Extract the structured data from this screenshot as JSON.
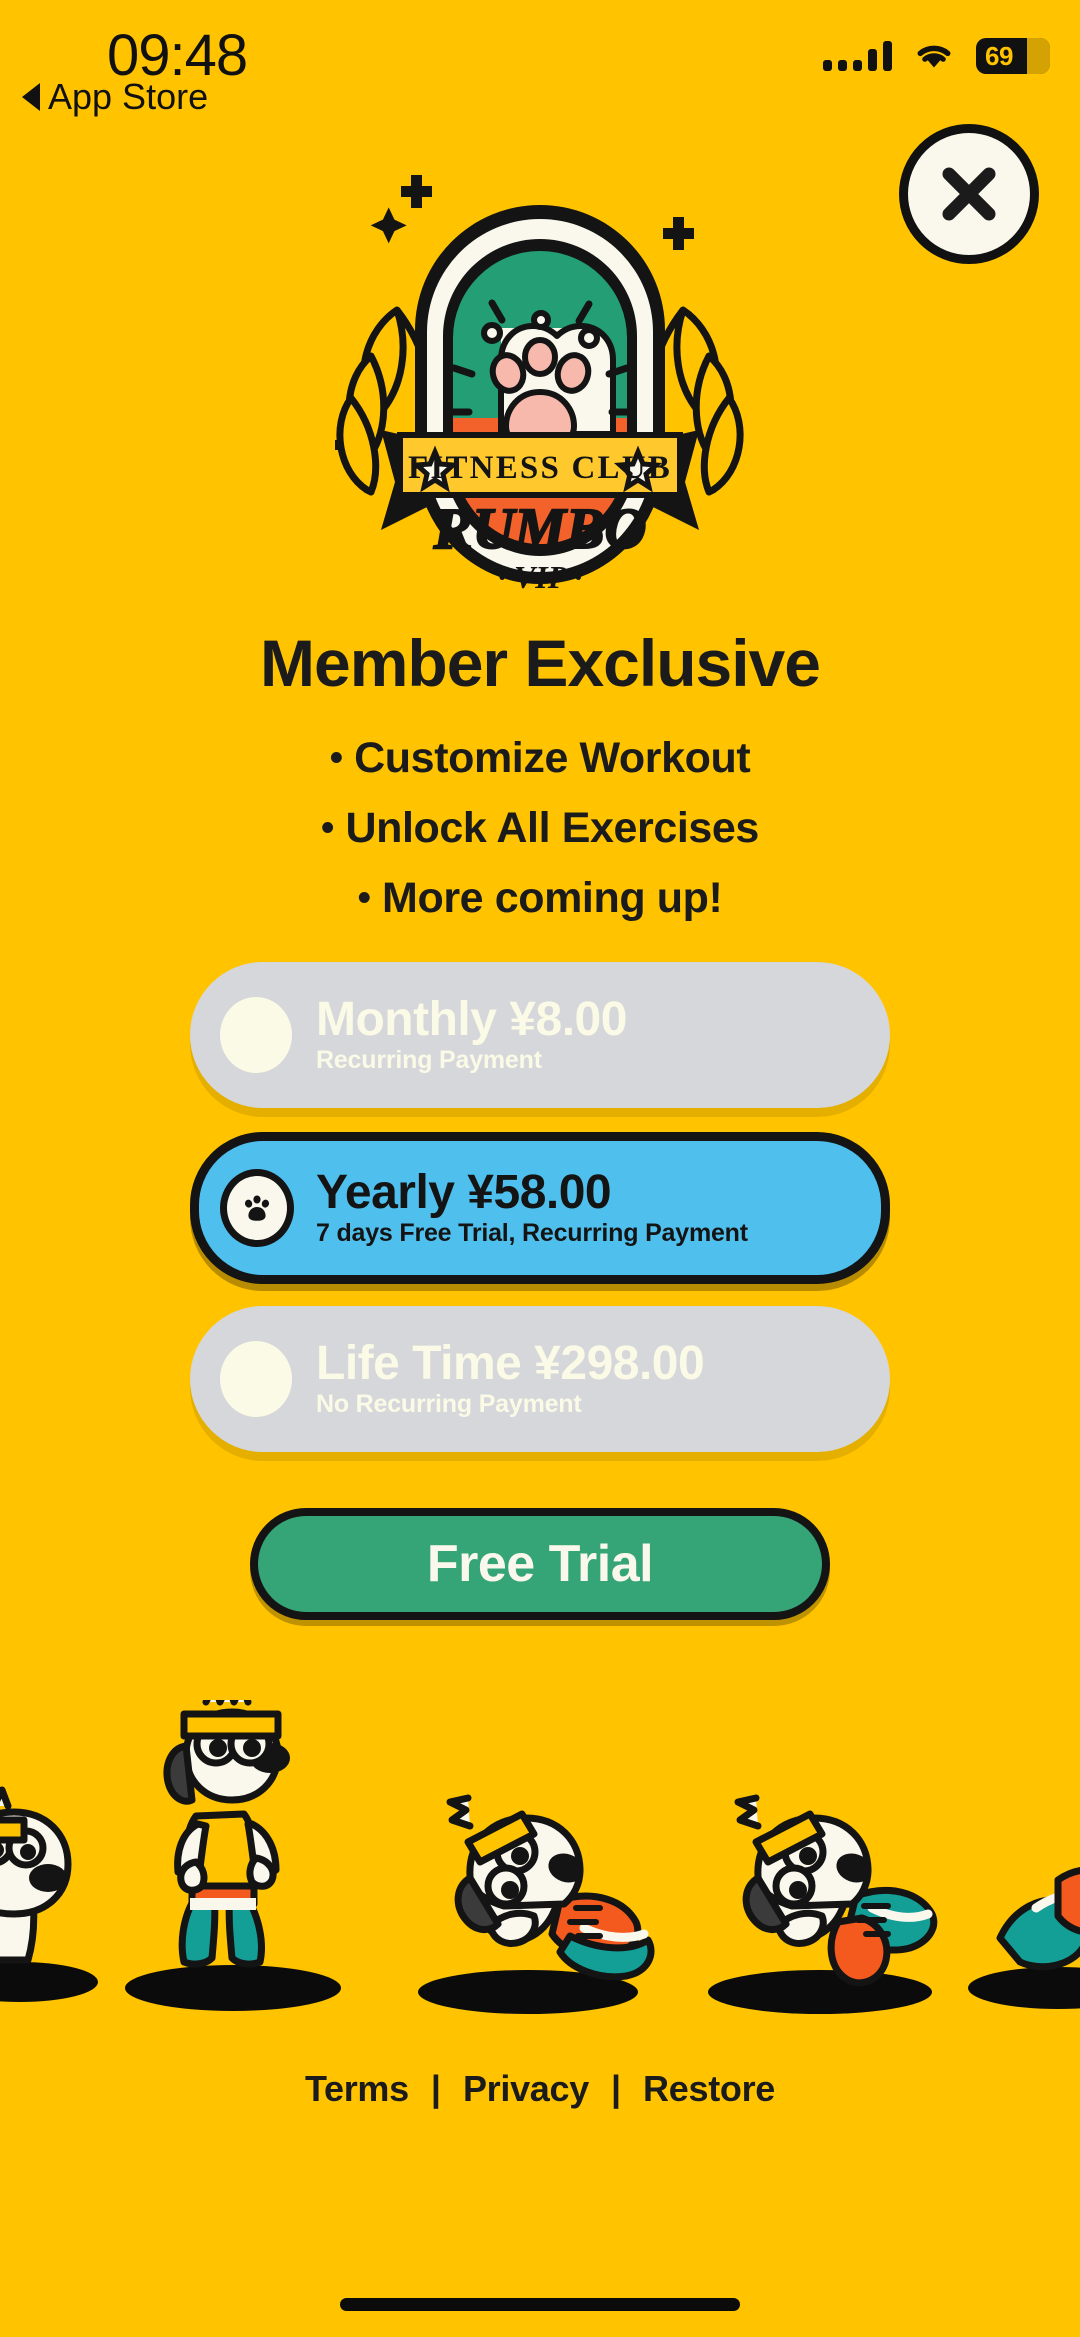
{
  "status_bar": {
    "time": "09:48",
    "back_label": "App Store",
    "battery_percent": "69",
    "icons": [
      "signal-bars-icon",
      "wifi-icon",
      "battery-icon"
    ]
  },
  "close_button": {
    "icon": "close-icon"
  },
  "logo": {
    "ribbon_text": "FITNESS CLUB",
    "brand_text": "RUMBO",
    "tier_text": "· VIP ·",
    "icon": "paw-badge-logo"
  },
  "header": {
    "title": "Member Exclusive",
    "features": [
      "Customize Workout",
      "Unlock All Exercises",
      "More coming up!"
    ],
    "bullet": "•"
  },
  "plans": [
    {
      "id": "monthly",
      "title": "Monthly ¥8.00",
      "subtitle": "Recurring Payment",
      "selected": false
    },
    {
      "id": "yearly",
      "title": "Yearly ¥58.00",
      "subtitle": "7 days Free Trial, Recurring Payment",
      "selected": true
    },
    {
      "id": "lifetime",
      "title": "Life Time ¥298.00",
      "subtitle": "No Recurring Payment",
      "selected": false
    }
  ],
  "cta": {
    "label": "Free Trial"
  },
  "footer": {
    "terms": "Terms",
    "privacy": "Privacy",
    "restore": "Restore",
    "separator": "|"
  },
  "colors": {
    "background": "#FFC300",
    "selected_plan": "#4FC0EE",
    "unselected_plan": "#D5D7DA",
    "cta": "#35A476",
    "ink": "#141414",
    "cream": "#FAF8EC",
    "badge_green": "#239E75",
    "badge_orange": "#F2622A",
    "paw_pink": "#F6B9AC",
    "mascot_teal": "#139E96",
    "mascot_orange": "#F4591E"
  }
}
